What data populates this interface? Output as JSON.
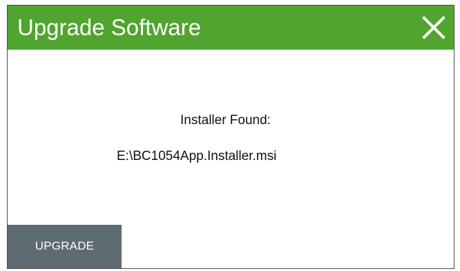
{
  "dialog": {
    "title": "Upgrade Software",
    "close_icon": "close-icon",
    "message": "Installer Found:",
    "file_path": "E:\\BC1054App.Installer.msi",
    "upgrade_label": "UPGRADE"
  },
  "colors": {
    "title_bar": "#4fa52e",
    "title_text": "#ffffff",
    "button_bg": "#5e6b72",
    "button_text": "#ffffff",
    "body_text": "#111111"
  }
}
